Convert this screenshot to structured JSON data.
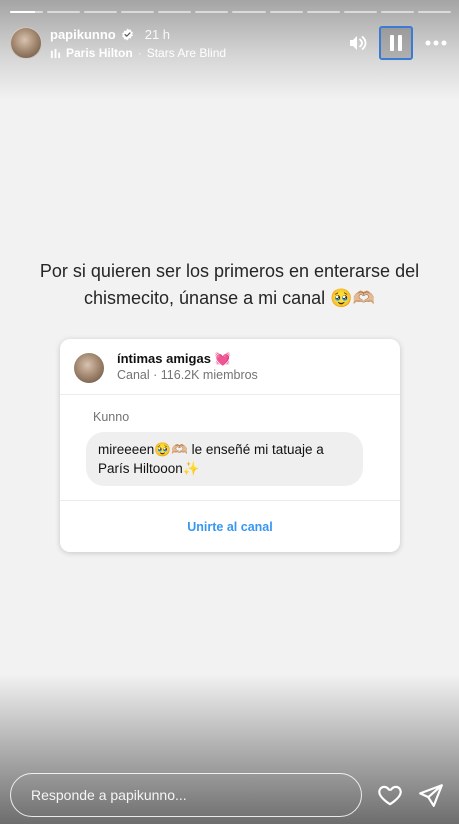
{
  "story": {
    "progress": [
      1,
      0,
      0,
      0,
      0,
      0,
      0,
      0,
      0,
      0,
      0,
      0
    ],
    "active_progress": 0.75
  },
  "header": {
    "username": "papikunno",
    "time": "21 h",
    "music_artist": "Paris Hilton",
    "music_separator": "·",
    "music_track": "Stars Are Blind",
    "icons": [
      "volume-icon",
      "pause-icon",
      "more-icon"
    ]
  },
  "caption": {
    "text": "Por si quieren ser los primeros en enterarse del chismecito, únanse a mi canal 🥹🫶🏼"
  },
  "channel_card": {
    "name": "íntimas amigas 💓",
    "meta": "Canal · 116.2K miembros",
    "sender": "Kunno",
    "message": "mireeeen🥹🫶🏼 le enseñé mi tatuaje a París Hiltooon✨",
    "join_label": "Unirte al canal"
  },
  "footer": {
    "reply_placeholder": "Responde a papikunno...",
    "icons": [
      "heart-icon",
      "send-icon"
    ]
  },
  "colors": {
    "background": "#f2f2f2",
    "link_blue": "#3897f0",
    "focus_border": "#3a7bd5"
  }
}
